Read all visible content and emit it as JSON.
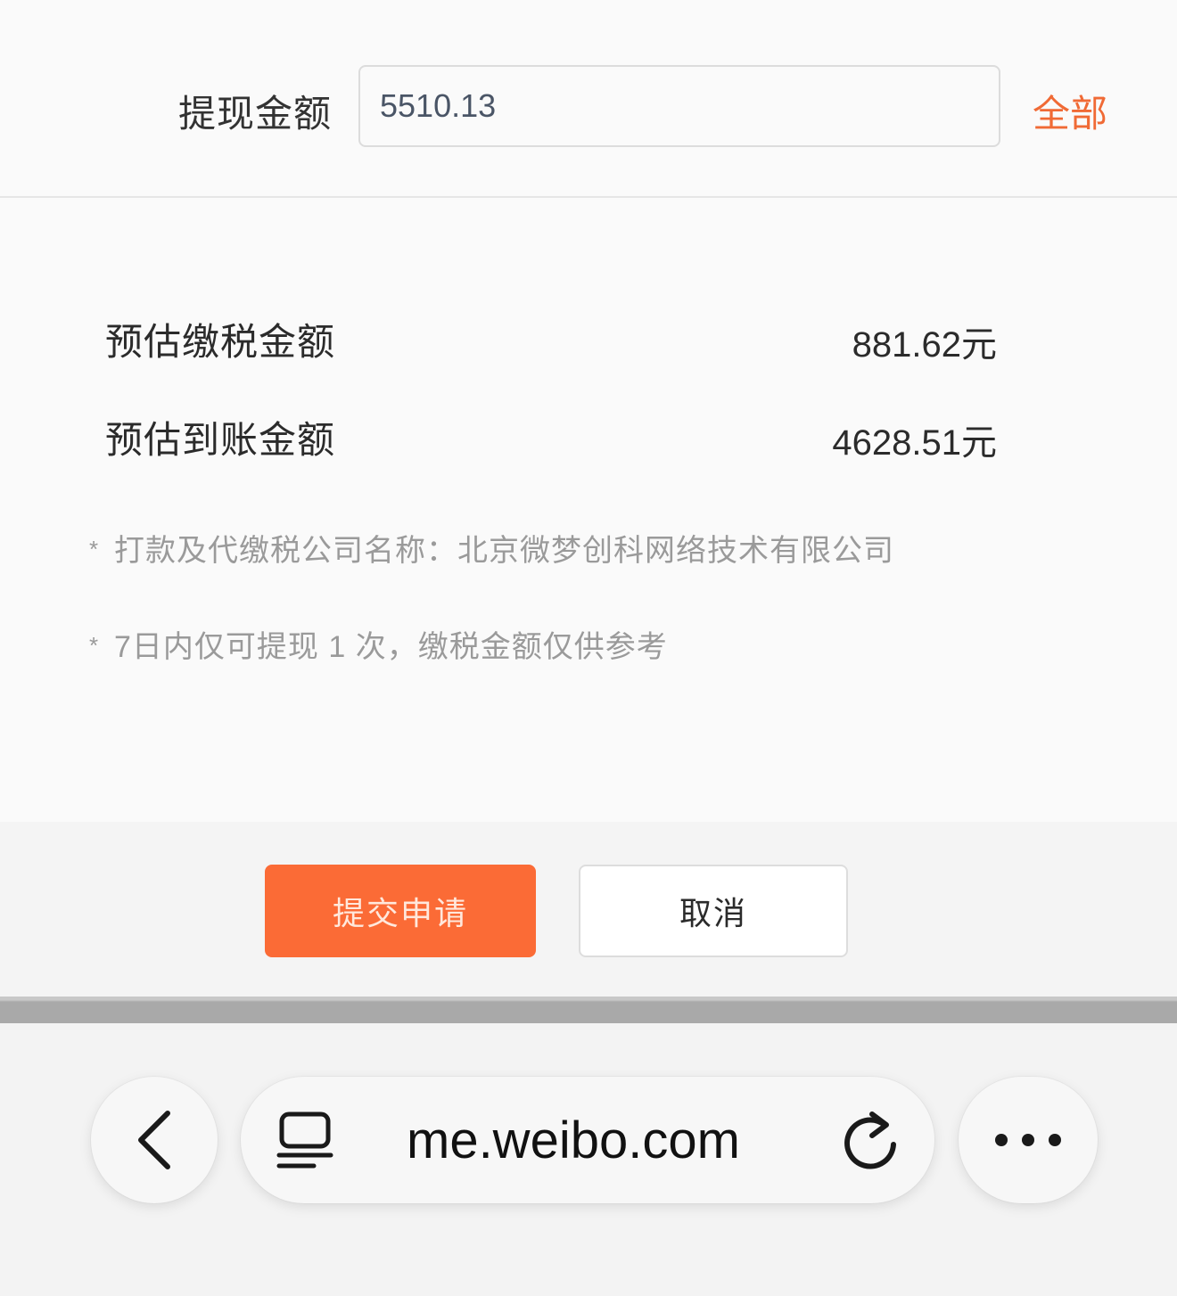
{
  "withdraw": {
    "label": "提现金额",
    "amount_value": "5510.13",
    "all_label": "全部"
  },
  "summary": {
    "tax_label": "预估缴税金额",
    "tax_value": "881.62元",
    "arrival_label": "预估到账金额",
    "arrival_value": "4628.51元"
  },
  "notes": [
    {
      "star": "*",
      "text": "打款及代缴税公司名称：北京微梦创科网络技术有限公司"
    },
    {
      "star": "*",
      "text": "7日内仅可提现 1 次，缴税金额仅供参考"
    }
  ],
  "actions": {
    "submit_label": "提交申请",
    "cancel_label": "取消"
  },
  "browser": {
    "url": "me.weibo.com",
    "back_icon": "chevron-left-icon",
    "reader_icon": "reader-mode-icon",
    "reload_icon": "reload-icon",
    "more_icon": "more-horizontal-icon"
  },
  "colors": {
    "accent": "#f06a35",
    "submit_bg": "#fb6b36",
    "text_primary": "#2b2b2b",
    "text_muted": "#9a9a9a"
  }
}
